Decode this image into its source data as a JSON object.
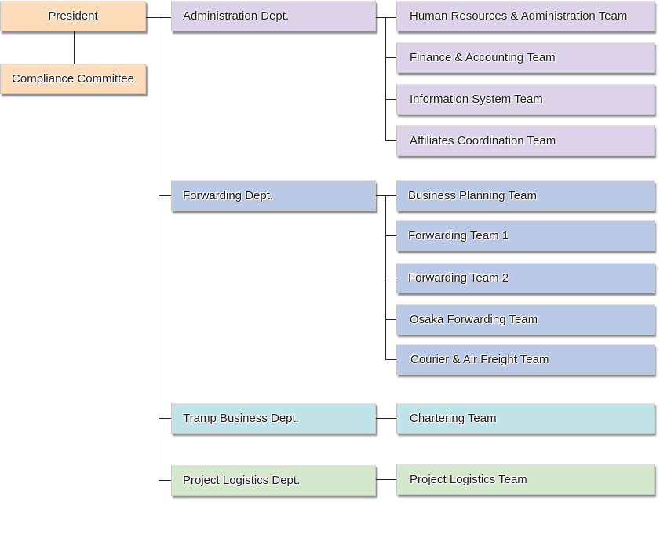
{
  "executive": {
    "president": "President",
    "compliance": "Compliance Committee"
  },
  "colors": {
    "executive": "#fcdcba",
    "administration": "#dcd3e8",
    "forwarding": "#bac9e6",
    "tramp": "#c0e4e8",
    "project": "#d6e8cc",
    "connector": "#222222"
  },
  "departments": [
    {
      "name": "Administration Dept.",
      "teams": [
        "Human Resources & Administration Team",
        "Finance & Accounting Team",
        "Information System Team",
        "Affiliates Coordination Team"
      ]
    },
    {
      "name": "Forwarding Dept.",
      "teams": [
        "Business Planning Team",
        "Forwarding Team 1",
        "Forwarding Team 2",
        "Osaka Forwarding Team",
        "Courier & Air Freight Team"
      ]
    },
    {
      "name": "Tramp Business Dept.",
      "teams": [
        "Chartering Team"
      ]
    },
    {
      "name": "Project Logistics Dept.",
      "teams": [
        "Project Logistics Team"
      ]
    }
  ]
}
